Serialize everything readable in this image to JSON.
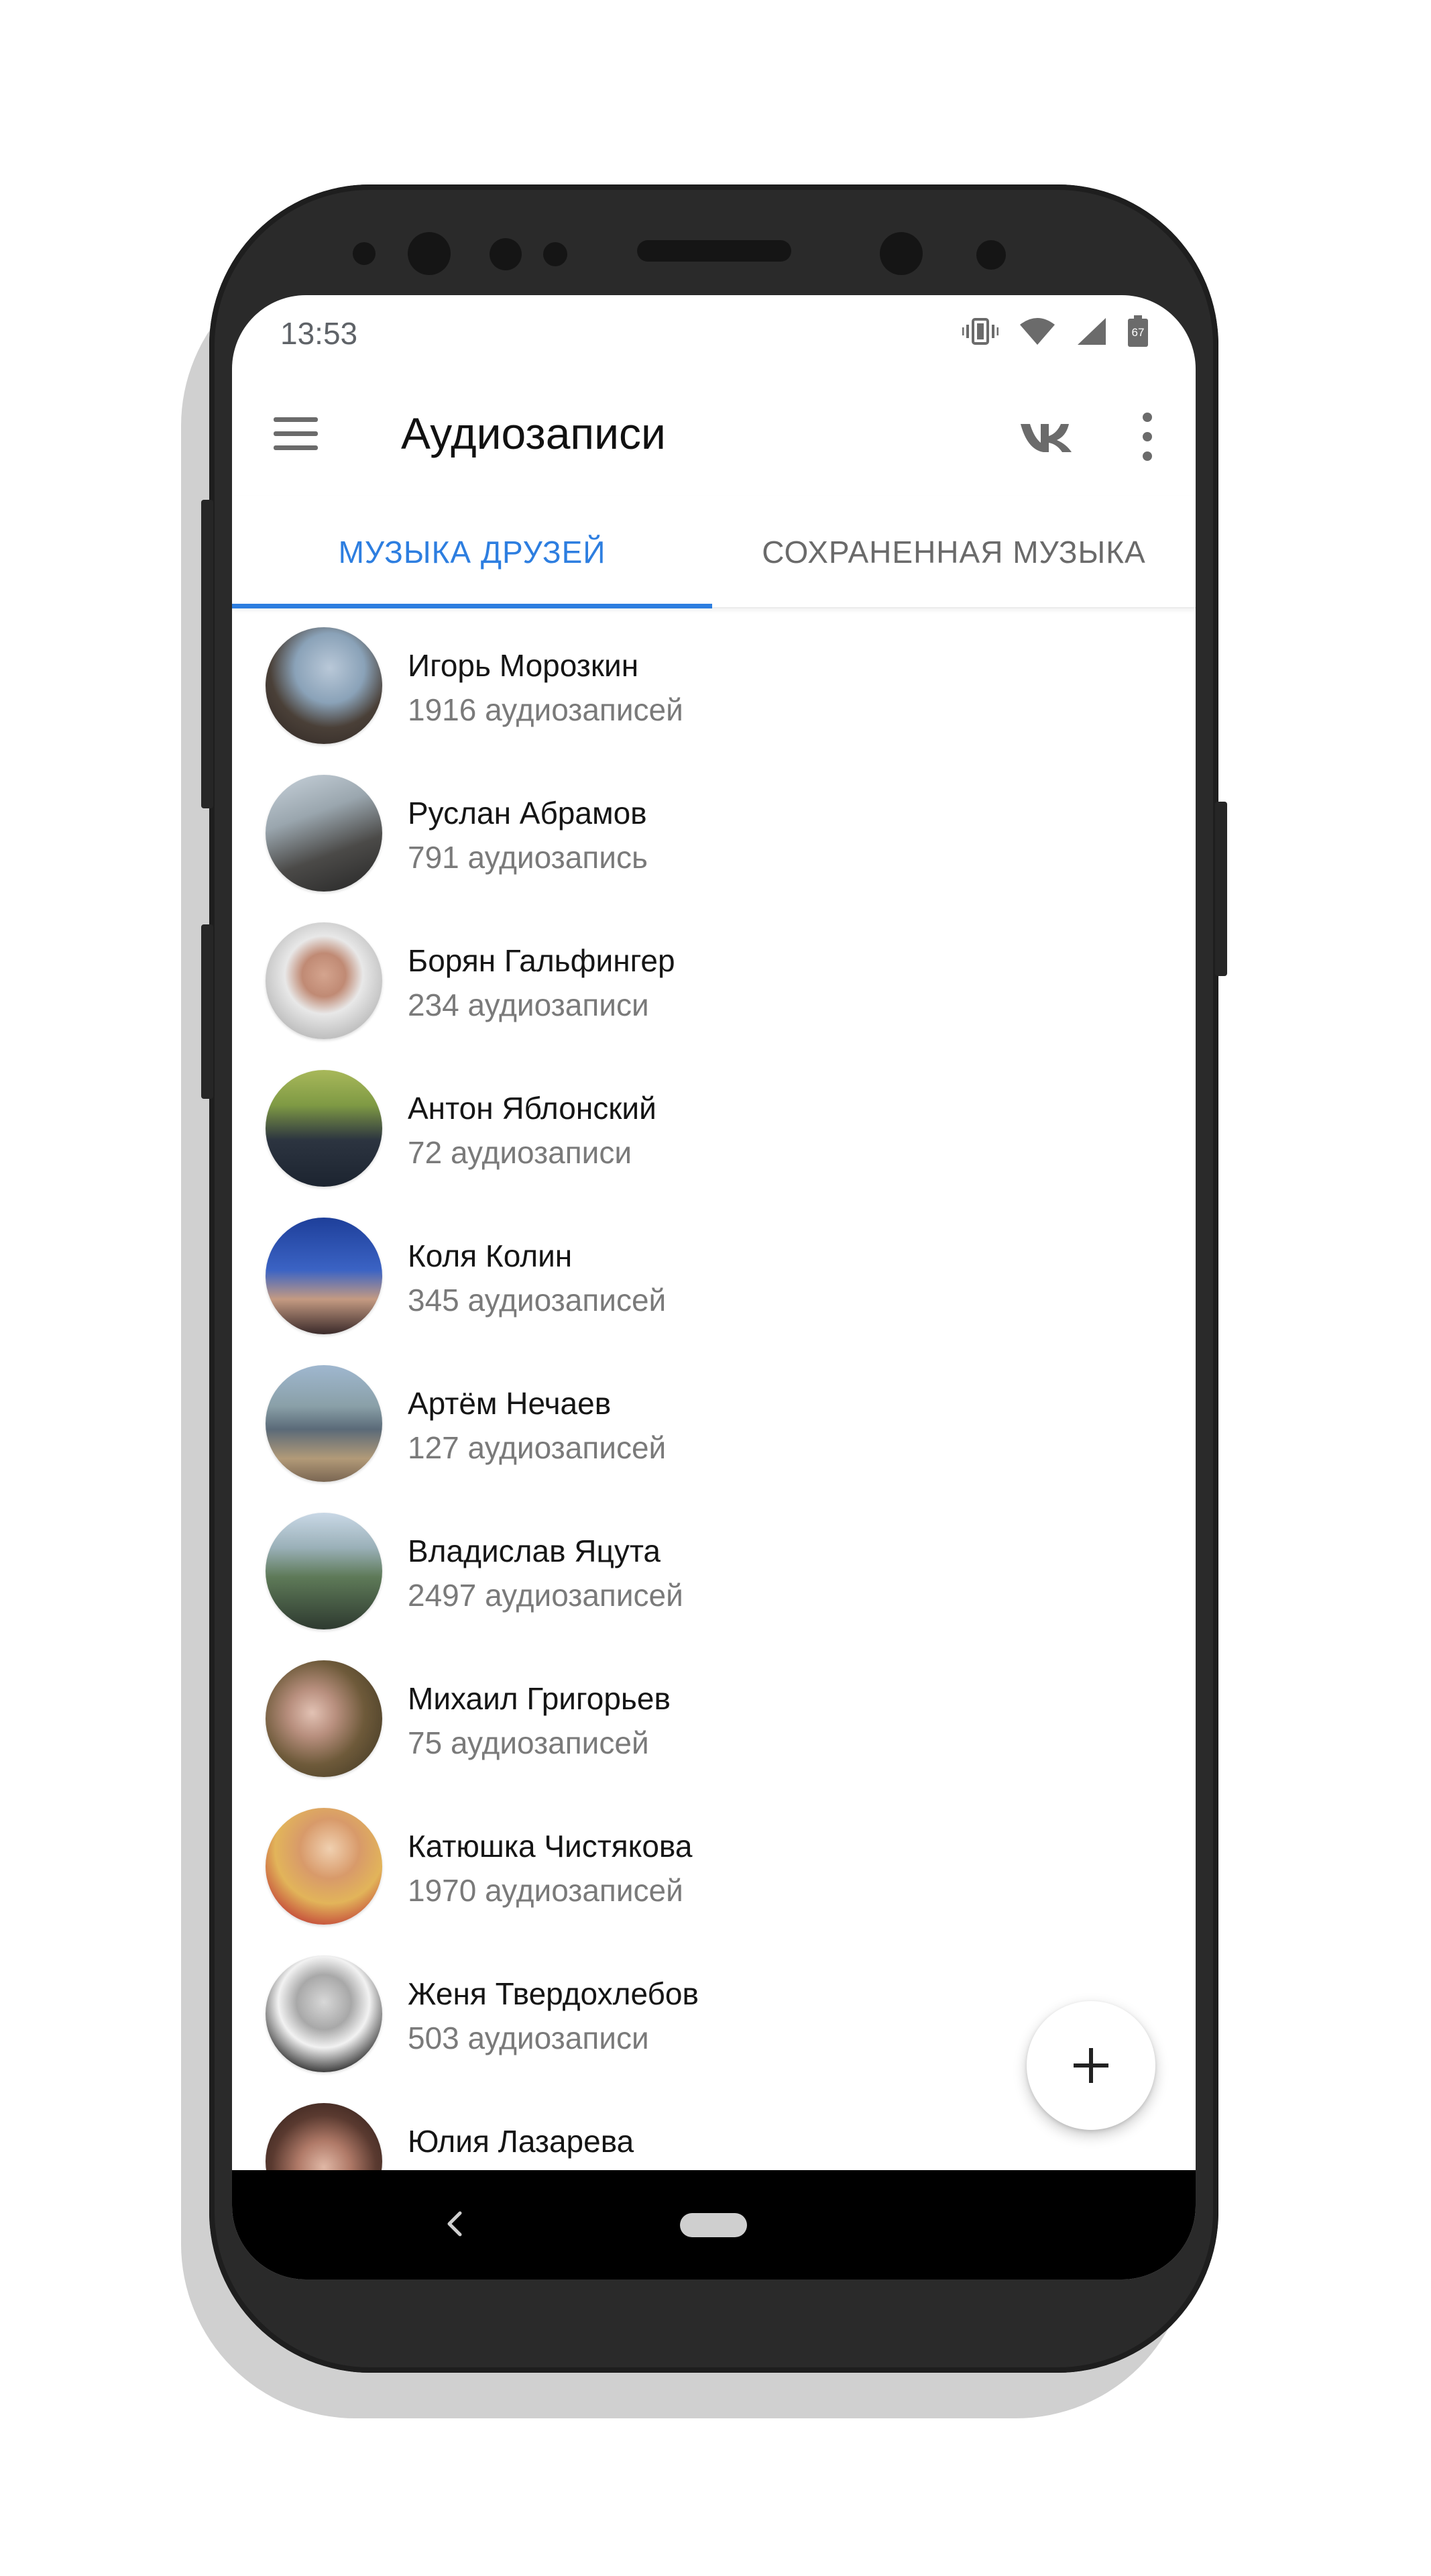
{
  "status_bar": {
    "time": "13:53",
    "battery": "67"
  },
  "app_bar": {
    "title": "Аудиозаписи",
    "menu_icon": "hamburger-menu-icon",
    "vk_icon": "vk-logo-icon",
    "more_icon": "more-vertical-icon"
  },
  "tabs": [
    {
      "label": "МУЗЫКА ДРУЗЕЙ",
      "active": true
    },
    {
      "label": "СОХРАНЕННАЯ МУЗЫКА",
      "active": false
    }
  ],
  "colors": {
    "accent": "#2d7ee0",
    "text_primary": "#151515",
    "text_secondary": "#7a7a7a"
  },
  "friends": [
    {
      "name": "Игорь Морозкин",
      "count": "1916 аудиозаписей"
    },
    {
      "name": "Руслан Абрамов",
      "count": "791 аудиозапись"
    },
    {
      "name": "Борян Гальфингер",
      "count": "234 аудиозаписи"
    },
    {
      "name": "Антон Яблонский",
      "count": "72 аудиозаписи"
    },
    {
      "name": "Коля Колин",
      "count": "345 аудиозаписей"
    },
    {
      "name": "Артём Нечаев",
      "count": "127 аудиозаписей"
    },
    {
      "name": "Владислав Яцута",
      "count": "2497 аудиозаписей"
    },
    {
      "name": "Михаил Григорьев",
      "count": "75 аудиозаписей"
    },
    {
      "name": "Катюшка Чистякова",
      "count": "1970 аудиозаписей"
    },
    {
      "name": "Женя Твердохлебов",
      "count": "503 аудиозаписи"
    },
    {
      "name": "Юлия Лазарева",
      "count": ""
    }
  ],
  "fab": {
    "icon": "plus-icon"
  },
  "nav": {
    "back_icon": "back-chevron-icon",
    "home_icon": "home-pill-icon"
  }
}
